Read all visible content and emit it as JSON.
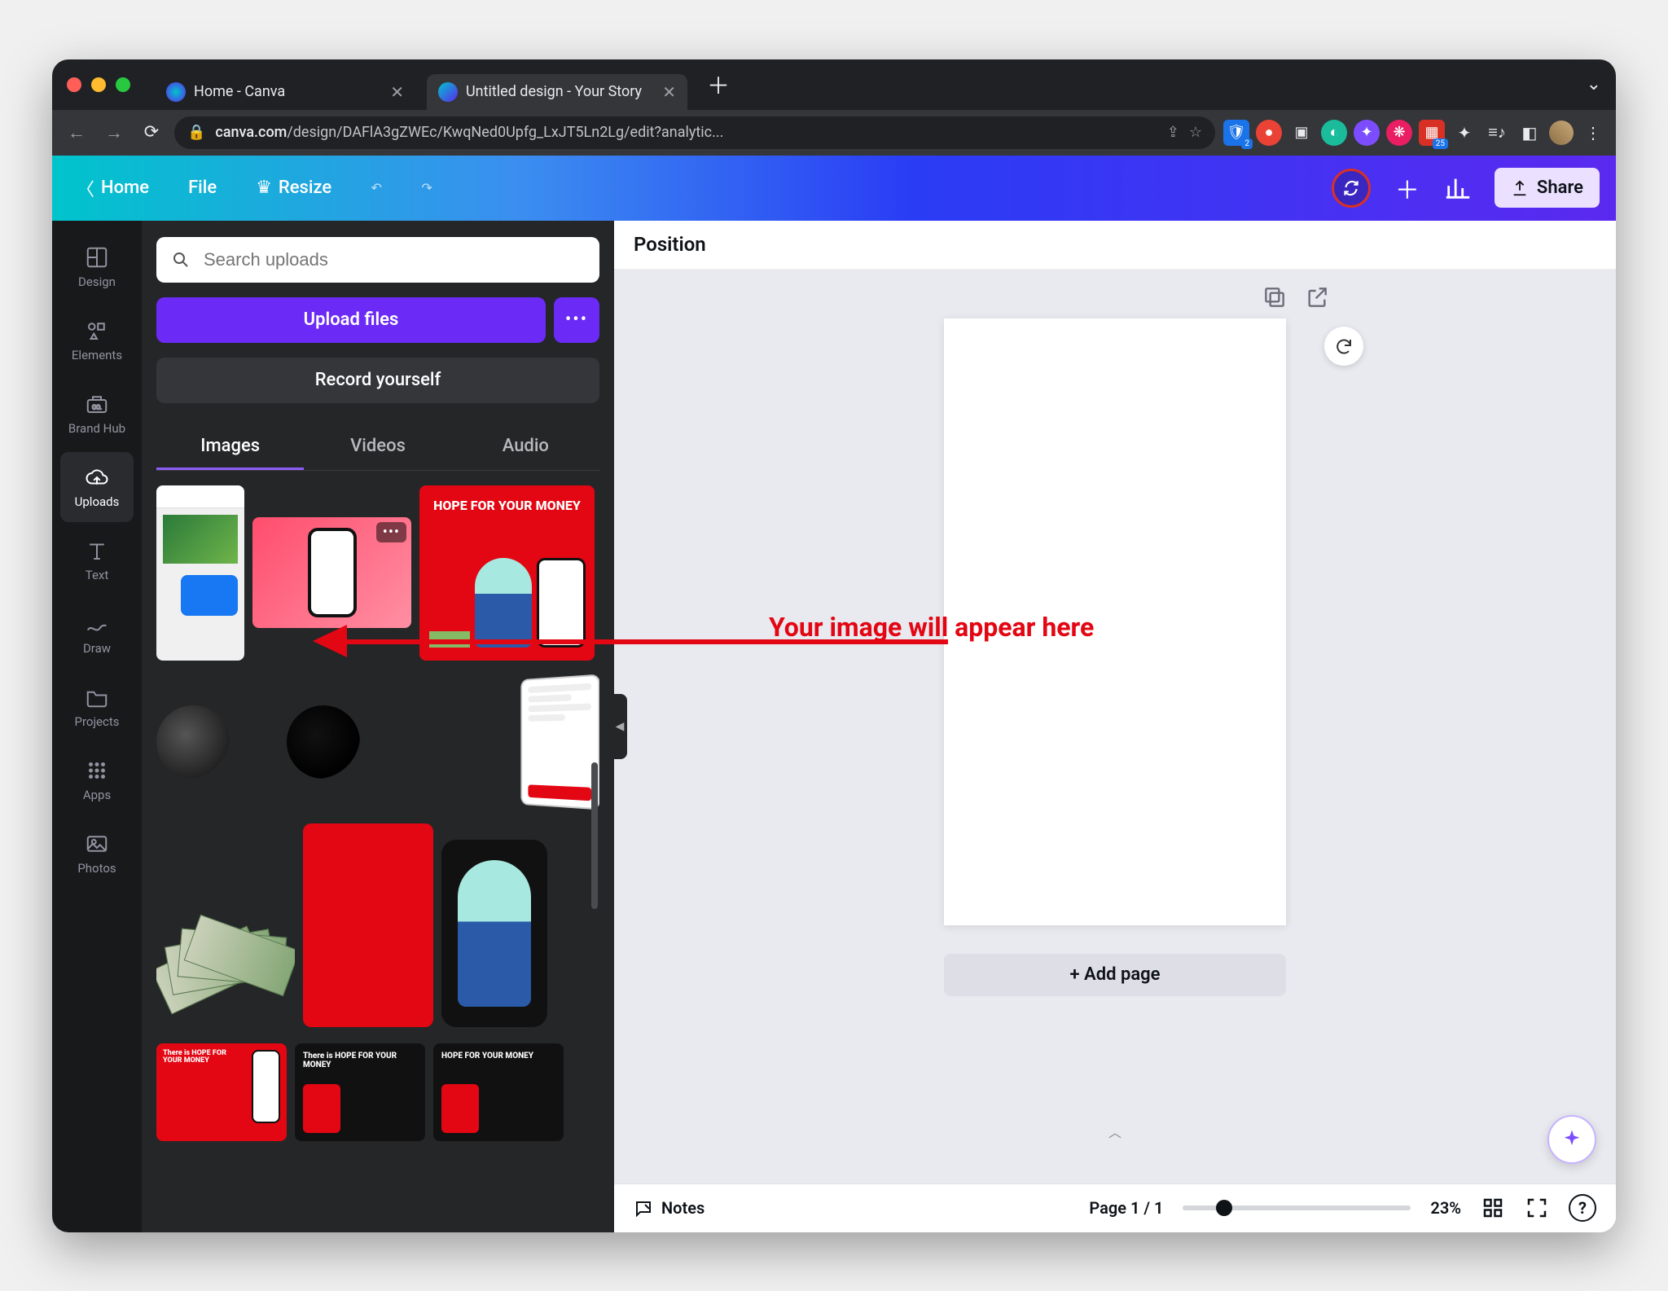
{
  "browser": {
    "tabs": [
      {
        "title": "Home - Canva",
        "active": false
      },
      {
        "title": "Untitled design - Your Story",
        "active": true
      }
    ],
    "url_host": "canva.com",
    "url_path": "/design/DAFlA3gZWEc/KwqNed0Upfg_LxJT5Ln2Lg/edit?analytic...",
    "ext_badge_1": "2",
    "ext_badge_2": "25"
  },
  "toolbar": {
    "home": "Home",
    "file": "File",
    "resize": "Resize",
    "share": "Share"
  },
  "rail": {
    "items": [
      {
        "key": "design",
        "label": "Design"
      },
      {
        "key": "elements",
        "label": "Elements"
      },
      {
        "key": "brandhub",
        "label": "Brand Hub"
      },
      {
        "key": "uploads",
        "label": "Uploads"
      },
      {
        "key": "text",
        "label": "Text"
      },
      {
        "key": "draw",
        "label": "Draw"
      },
      {
        "key": "projects",
        "label": "Projects"
      },
      {
        "key": "apps",
        "label": "Apps"
      },
      {
        "key": "photos",
        "label": "Photos"
      }
    ],
    "active": "uploads"
  },
  "panel": {
    "search_placeholder": "Search uploads",
    "upload_label": "Upload files",
    "record_label": "Record yourself",
    "tabs": {
      "images": "Images",
      "videos": "Videos",
      "audio": "Audio",
      "active": "images"
    },
    "thumb_text": {
      "hope": "HOPE FOR YOUR MONEY",
      "hope2": "There is HOPE FOR YOUR MONEY"
    }
  },
  "context": {
    "position": "Position"
  },
  "canvas": {
    "add_page": "+ Add page"
  },
  "footer": {
    "notes": "Notes",
    "pager": "Page 1 / 1",
    "zoom": "23%"
  },
  "annotation": {
    "text": "Your image will appear here"
  }
}
